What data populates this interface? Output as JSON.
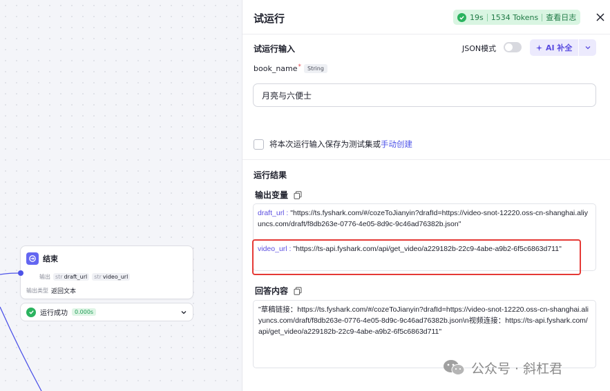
{
  "canvas": {
    "end_node": {
      "title": "结束",
      "output_label": "输出",
      "vars": [
        {
          "type": "str",
          "name": "draft_url"
        },
        {
          "type": "str",
          "name": "video_url"
        }
      ],
      "output_type_label": "输出类型",
      "output_type_value": "返回文本"
    },
    "run_status": {
      "label": "运行成功",
      "time": "0.000s"
    }
  },
  "panel": {
    "title": "试运行",
    "stats": {
      "duration": "19s",
      "tokens": "1534 Tokens",
      "log_link": "查看日志"
    },
    "input_section": {
      "title": "试运行输入",
      "json_mode_label": "JSON模式",
      "json_mode_on": false,
      "ai_button": "AI 补全",
      "field": {
        "name": "book_name",
        "required_mark": "*",
        "type": "String",
        "value": "月亮与六便士"
      },
      "save_text": "将本次运行输入保存为测试集或",
      "save_link": "手动创建"
    },
    "result_section": {
      "title": "运行结果",
      "output_vars_title": "输出变量",
      "draft_key": "draft_url :",
      "draft_value": "\"https://ts.fyshark.com/#/cozeToJianyin?drafId=https://video-snot-12220.oss-cn-shanghai.aliyuncs.com/draft/f8db263e-0776-4e05-8d9c-9c46ad76382b.json\"",
      "video_key": "video_url :",
      "video_value": "\"https://ts-api.fyshark.com/api/get_video/a229182b-22c9-4abe-a9b2-6f5c6863d711\"",
      "answer_title": "回答内容",
      "answer_text": "\"草稿链接：https://ts.fyshark.com/#/cozeToJianyin?drafId=https://video-snot-12220.oss-cn-shanghai.aliyuncs.com/draft/f8db263e-0776-4e05-8d9c-9c46ad76382b.json\\n视频连接：https://ts-api.fyshark.com/api/get_video/a229182b-22c9-4abe-a9b2-6f5c6863d711\""
    }
  },
  "watermark": {
    "text": "公众号 · 斜杠君"
  },
  "colors": {
    "accent": "#4d53e8",
    "success": "#2bb35f",
    "highlight": "#e53935"
  }
}
